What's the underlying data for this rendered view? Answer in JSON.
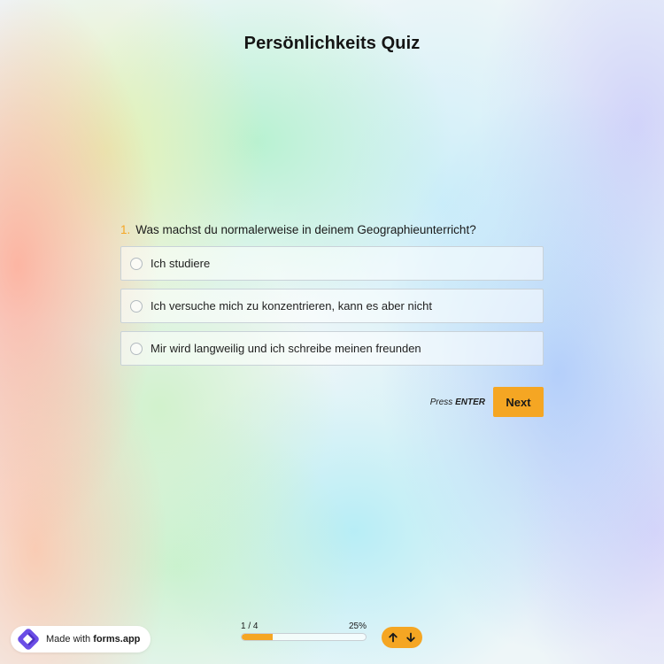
{
  "quiz": {
    "title": "Persönlichkeits Quiz"
  },
  "question": {
    "number": "1.",
    "text": "Was machst du normalerweise in deinem Geographieunterricht?",
    "options": [
      {
        "label": "Ich studiere"
      },
      {
        "label": "Ich versuche mich zu konzentrieren, kann es aber nicht"
      },
      {
        "label": "Mir wird langweilig und ich schreibe meinen freunden"
      }
    ]
  },
  "actions": {
    "press_prefix": "Press",
    "press_key": "ENTER",
    "next_label": "Next"
  },
  "footer": {
    "brand_prefix": "Made with",
    "brand_name": "forms.app",
    "brand_icon": "forms-app-logo-icon",
    "progress_text": "1 / 4",
    "progress_percent_text": "25%",
    "progress_fraction": 0.25,
    "nav_icons": [
      "arrow-up-icon",
      "arrow-down-icon"
    ]
  },
  "colors": {
    "accent": "#f5a623",
    "brand_purple": "#6b4ee6"
  }
}
